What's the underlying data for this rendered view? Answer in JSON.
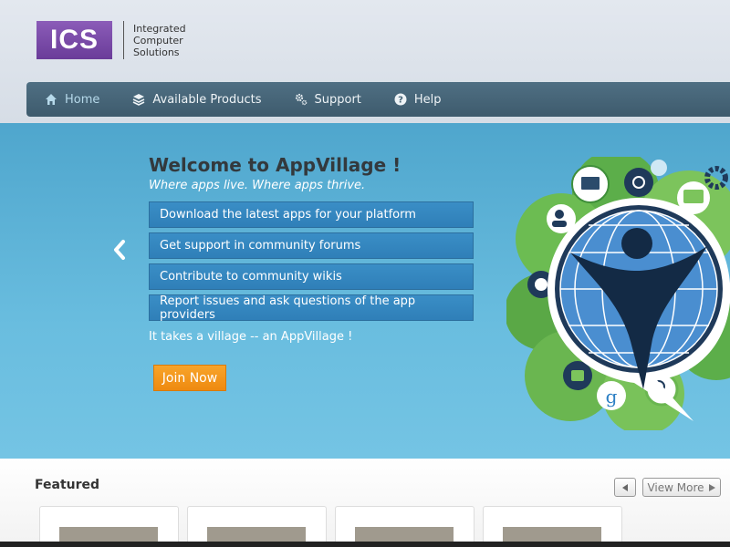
{
  "logo": {
    "abbr": "ICS",
    "line1": "Integrated",
    "line2": "Computer",
    "line3": "Solutions"
  },
  "nav": {
    "items": [
      {
        "label": "Home",
        "icon": "home-icon",
        "active": true
      },
      {
        "label": "Available Products",
        "icon": "layers-icon"
      },
      {
        "label": "Support",
        "icon": "gears-icon"
      },
      {
        "label": "Help",
        "icon": "help-icon"
      }
    ]
  },
  "hero": {
    "title": "Welcome to AppVillage !",
    "subtitle": "Where apps live. Where apps thrive.",
    "features": [
      "Download the latest apps for your platform",
      "Get support in community forums",
      "Contribute to community wikis",
      "Report issues and ask questions of the app providers"
    ],
    "tagline": "It takes a village -- an AppVillage !",
    "join_label": "Join Now",
    "prev_icon": "chevron-left-icon"
  },
  "featured": {
    "title": "Featured",
    "view_more_label": "View More",
    "prev_icon": "triangle-left-icon",
    "next_icon": "triangle-right-icon"
  },
  "colors": {
    "brand_purple": "#7a4aa9",
    "nav_bg": "#466477",
    "hero_bg": "#5fb2d8",
    "feature_bg": "#3386bf",
    "join_orange": "#f39a1c"
  }
}
